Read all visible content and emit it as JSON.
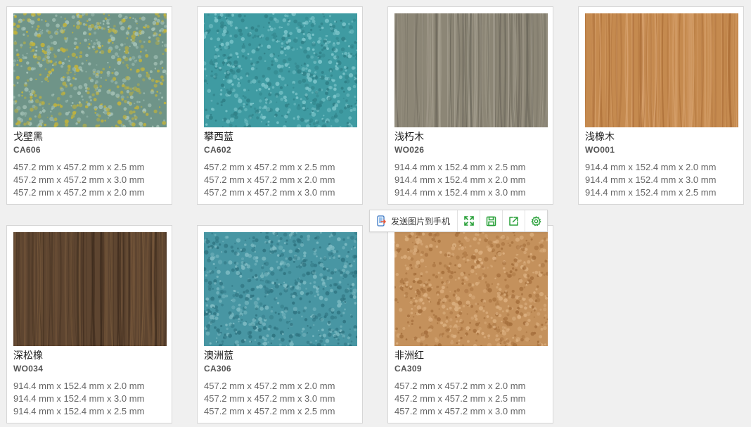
{
  "cards": [
    {
      "name": "戈壁黑",
      "code": "CA606",
      "sizes": [
        "457.2 mm x 457.2 mm x 2.5 mm",
        "457.2 mm x 457.2 mm x 3.0 mm",
        "457.2 mm x 457.2 mm x 2.0 mm"
      ],
      "texture": "carpet",
      "colors": [
        "#6f9488",
        "#a7c4b8",
        "#c3b43a"
      ]
    },
    {
      "name": "攀西蓝",
      "code": "CA602",
      "sizes": [
        "457.2 mm x 457.2 mm x 2.5 mm",
        "457.2 mm x 457.2 mm x 2.0 mm",
        "457.2 mm x 457.2 mm x 3.0 mm"
      ],
      "texture": "carpet",
      "colors": [
        "#3f9ba2",
        "#7fc7cc",
        "#2f7f86"
      ]
    },
    {
      "name": "浅朽木",
      "code": "WO026",
      "sizes": [
        "914.4 mm x 152.4 mm x 2.5 mm",
        "914.4 mm x 152.4 mm x 2.0 mm",
        "914.4 mm x 152.4 mm x 3.0 mm"
      ],
      "texture": "wood",
      "colors": [
        "#8c8676",
        "#6b665a",
        "#a9a394"
      ]
    },
    {
      "name": "浅橡木",
      "code": "WO001",
      "sizes": [
        "914.4 mm x 152.4 mm x 2.0 mm",
        "914.4 mm x 152.4 mm x 3.0 mm",
        "914.4 mm x 152.4 mm x 2.5 mm"
      ],
      "texture": "wood",
      "colors": [
        "#c58a4f",
        "#a86a34",
        "#d9a470"
      ]
    },
    {
      "name": "深松橡",
      "code": "WO034",
      "sizes": [
        "914.4 mm x 152.4 mm x 2.0 mm",
        "914.4 mm x 152.4 mm x 3.0 mm",
        "914.4 mm x 152.4 mm x 2.5 mm"
      ],
      "texture": "wood",
      "colors": [
        "#5e4530",
        "#3d2b1d",
        "#7a5b3d"
      ]
    },
    {
      "name": "澳洲蓝",
      "code": "CA306",
      "sizes": [
        "457.2 mm x 457.2 mm x 2.0 mm",
        "457.2 mm x 457.2 mm x 3.0 mm",
        "457.2 mm x 457.2 mm x 2.5 mm"
      ],
      "texture": "carpet",
      "colors": [
        "#4896a3",
        "#7fbcc4",
        "#2e7380"
      ]
    },
    {
      "name": "非洲红",
      "code": "CA309",
      "sizes": [
        "457.2 mm x 457.2 mm x 2.0 mm",
        "457.2 mm x 457.2 mm x 2.5 mm",
        "457.2 mm x 457.2 mm x 3.0 mm"
      ],
      "texture": "carpet",
      "colors": [
        "#c4915c",
        "#dcb080",
        "#a56f3c"
      ]
    }
  ],
  "toolbar": {
    "send_label": "发送图片到手机",
    "accent": "#2aa13a",
    "icons": [
      "phone-send-icon",
      "fullscreen-icon",
      "save-icon",
      "share-icon",
      "gear-icon"
    ]
  }
}
